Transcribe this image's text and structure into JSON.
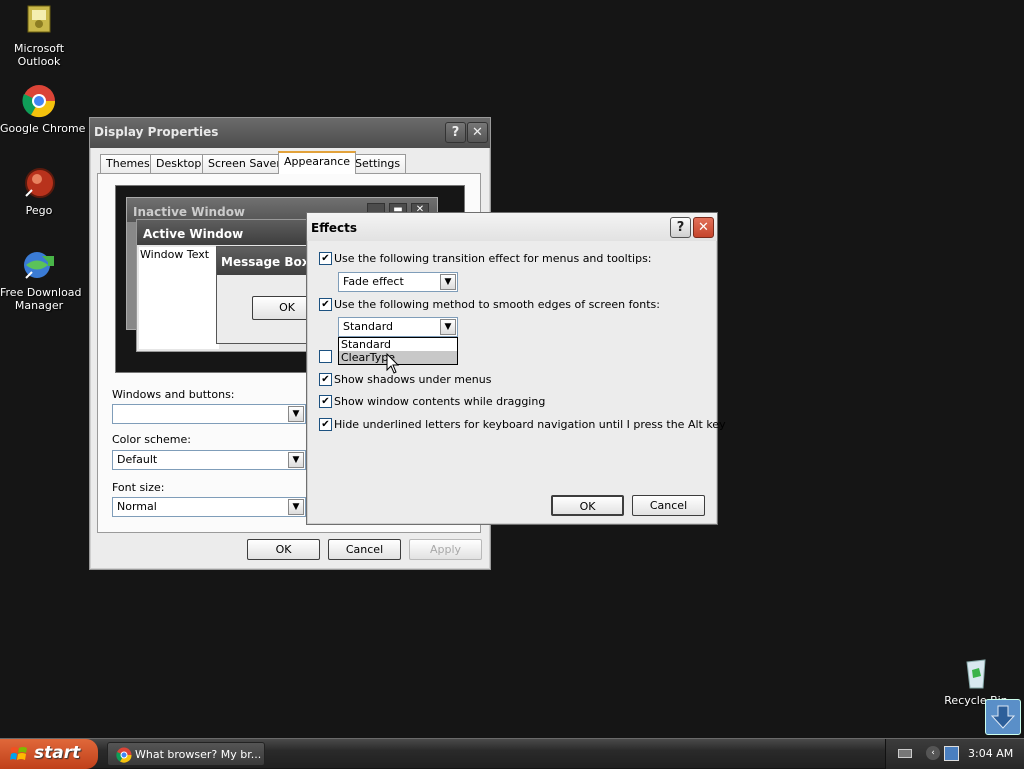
{
  "desktop": {
    "icons": [
      {
        "name": "outlook",
        "label_lines": [
          "Microsoft",
          "Outlook"
        ]
      },
      {
        "name": "chrome",
        "label_lines": [
          "Google Chrome"
        ]
      },
      {
        "name": "pego",
        "label_lines": [
          "Pego"
        ]
      },
      {
        "name": "fdm",
        "label_lines": [
          "Free Download",
          "Manager"
        ]
      },
      {
        "name": "recycle",
        "label_lines": [
          "Recycle Bin"
        ]
      }
    ]
  },
  "display_properties": {
    "title": "Display Properties",
    "help_glyph": "?",
    "close_glyph": "✕",
    "tabs": [
      "Themes",
      "Desktop",
      "Screen Saver",
      "Appearance",
      "Settings"
    ],
    "selected_tab": "Appearance",
    "preview": {
      "inactive_title": "Inactive Window",
      "active_title": "Active Window",
      "window_text": "Window Text",
      "message_box_title": "Message Box",
      "message_box_ok": "OK"
    },
    "windows_buttons_label": "Windows and buttons:",
    "windows_buttons_value": "",
    "color_scheme_label": "Color scheme:",
    "color_scheme_value": "Default",
    "font_size_label": "Font size:",
    "font_size_value": "Normal",
    "ok": "OK",
    "cancel": "Cancel",
    "apply": "Apply"
  },
  "effects": {
    "title": "Effects",
    "help_glyph": "?",
    "close_glyph": "✕",
    "transition_label": "Use the following transition effect for menus and tooltips:",
    "transition_checked": true,
    "transition_value": "Fade effect",
    "smoothing_label": "Use the following method to smooth edges of screen fonts:",
    "smoothing_checked": true,
    "smoothing_value": "Standard",
    "smoothing_options": [
      "Standard",
      "ClearType"
    ],
    "smoothing_highlighted": "ClearType",
    "large_icons_checked": false,
    "shadows_label": "Show shadows under menus",
    "shadows_checked": true,
    "drag_label": "Show window contents while dragging",
    "drag_checked": true,
    "underline_label": "Hide underlined letters for keyboard navigation until I press the Alt key",
    "underline_checked": true,
    "ok": "OK",
    "cancel": "Cancel",
    "check_glyph": "✔"
  },
  "taskbar": {
    "start_label": "start",
    "task_label": "What browser? My br...",
    "clock": "3:04 AM"
  },
  "colors": {
    "desktop_bg": "#151515",
    "start_orange": "#d0542a",
    "listbox_highlight": "#c8c8c8"
  }
}
